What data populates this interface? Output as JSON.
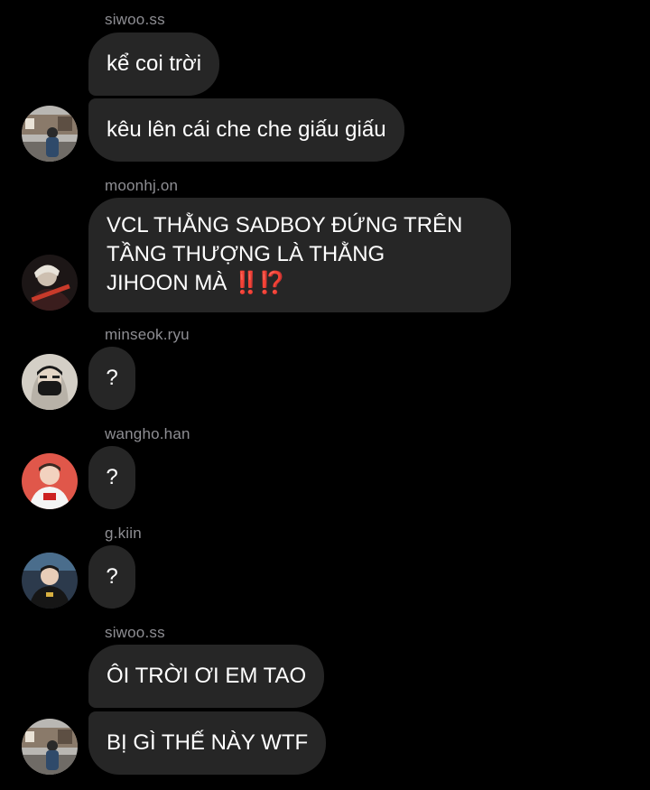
{
  "messages": [
    {
      "sender": "siwoo.ss",
      "text": "kể coi trời"
    },
    {
      "text": "kêu lên cái che che giấu giấu"
    },
    {
      "sender": "moonhj.on",
      "lines": [
        "VCL THẰNG SADBOY ĐỨNG TRÊN",
        "TẦNG THƯỢNG LÀ THẰNG",
        "JIHOON MÀ"
      ],
      "emoji": "‼️⁉️"
    },
    {
      "sender": "minseok.ryu",
      "text": "?"
    },
    {
      "sender": "wangho.han",
      "text": "?"
    },
    {
      "sender": "g.kiin",
      "text": "?"
    },
    {
      "sender": "siwoo.ss",
      "text": "ÔI TRỜI ƠI EM TAO"
    },
    {
      "text": "BỊ GÌ THẾ NÀY WTF"
    }
  ],
  "colors": {
    "background": "#000000",
    "bubble": "#262626",
    "sender_name": "#8e8e93",
    "emoji_red": "#e0241b"
  },
  "icons": {
    "avatar_siwoo": "avatar-photo-street",
    "avatar_moonhj": "avatar-photo-dark",
    "avatar_minseok": "avatar-photo-masked",
    "avatar_wangho": "avatar-photo-red",
    "avatar_gkiin": "avatar-photo-team"
  }
}
